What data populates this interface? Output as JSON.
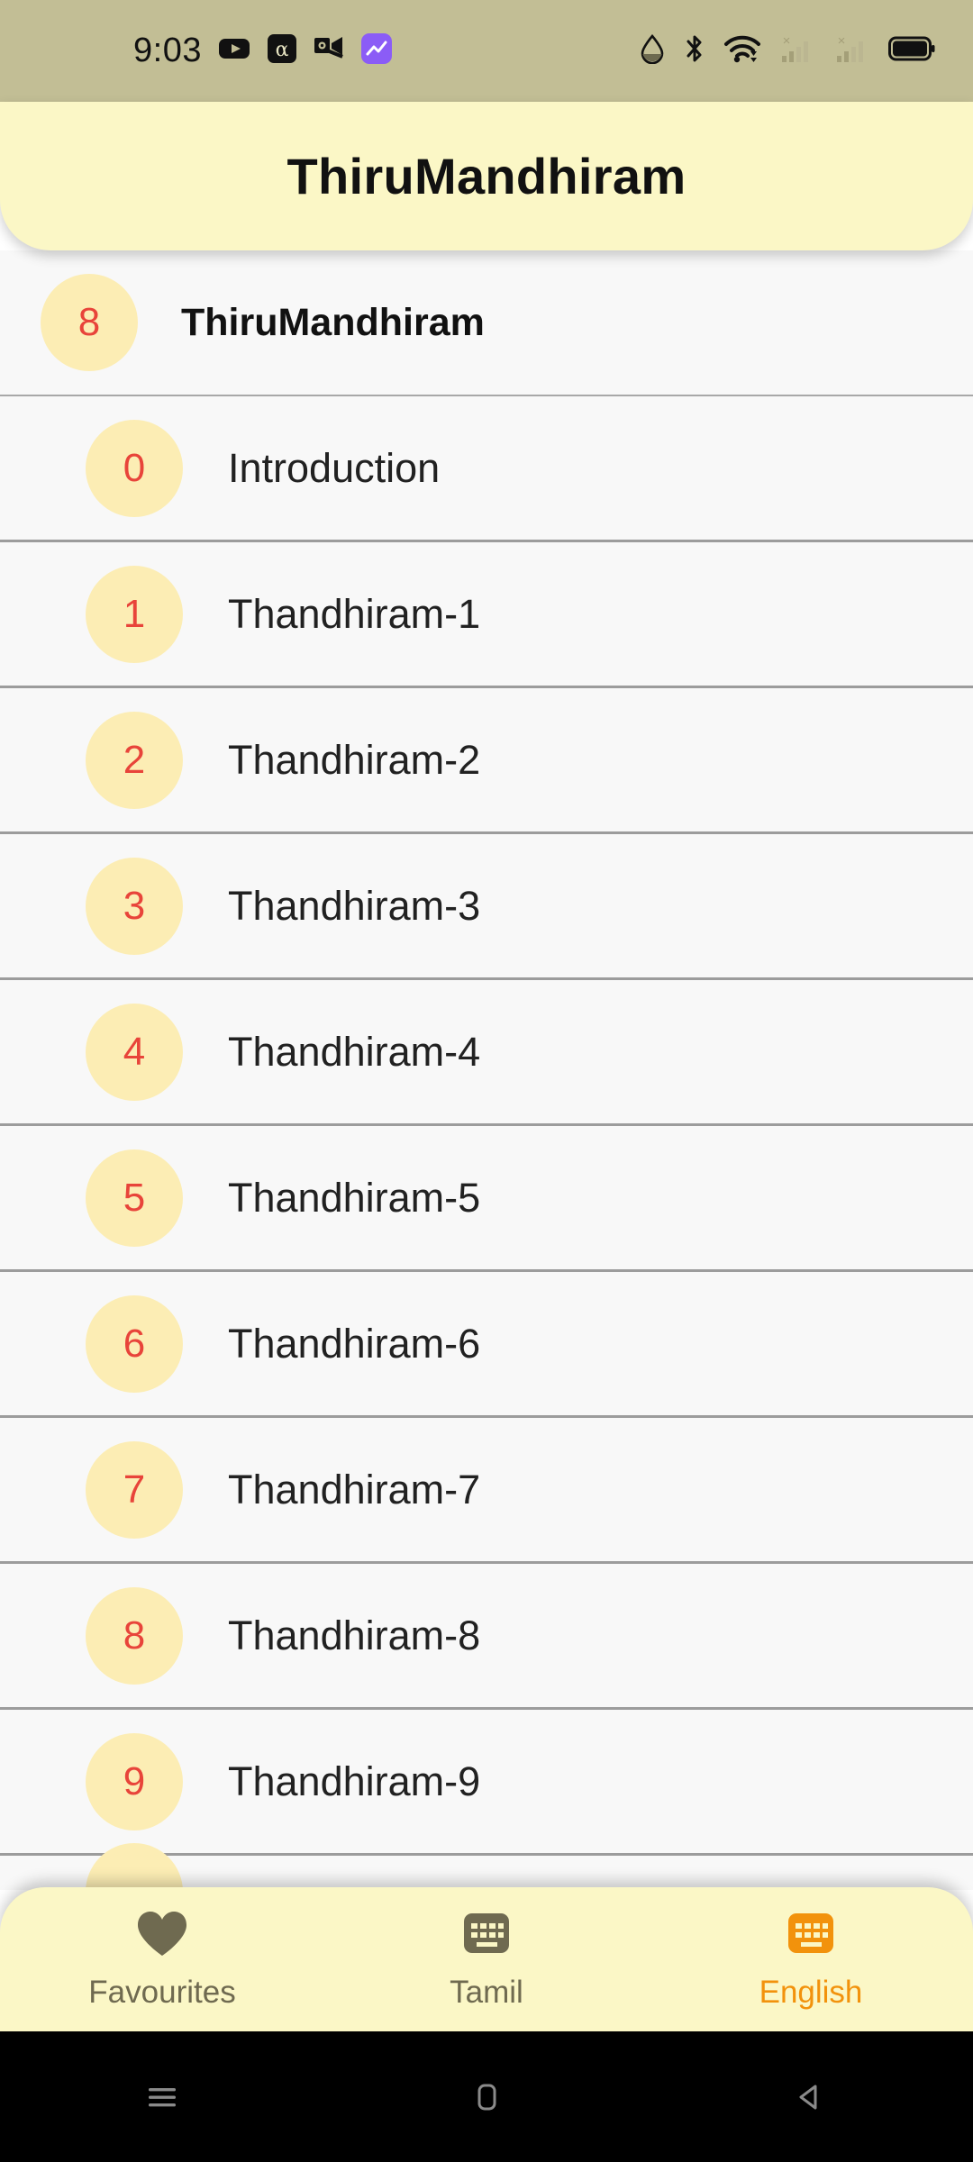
{
  "status_bar": {
    "time": "9:03",
    "background_color": "#c2be95",
    "left_icons": [
      "youtube-icon",
      "alpha-icon",
      "outlook-icon",
      "chart-app-icon"
    ],
    "right_icons": [
      "water-drop-icon",
      "bluetooth-icon",
      "wifi-icon",
      "signal-1-no-service-icon",
      "signal-2-no-service-icon",
      "battery-icon"
    ]
  },
  "header": {
    "title": "ThiruMandhiram",
    "background_color": "#fbf7c6"
  },
  "list": {
    "background_color": "#f8f8f8",
    "badge_color": "#fcedb4",
    "badge_text_color": "#e8443a",
    "items": [
      {
        "number": "8",
        "label": "ThiruMandhiram",
        "header_row": true
      },
      {
        "number": "0",
        "label": "Introduction",
        "header_row": false
      },
      {
        "number": "1",
        "label": "Thandhiram-1",
        "header_row": false
      },
      {
        "number": "2",
        "label": "Thandhiram-2",
        "header_row": false
      },
      {
        "number": "3",
        "label": "Thandhiram-3",
        "header_row": false
      },
      {
        "number": "4",
        "label": "Thandhiram-4",
        "header_row": false
      },
      {
        "number": "5",
        "label": "Thandhiram-5",
        "header_row": false
      },
      {
        "number": "6",
        "label": "Thandhiram-6",
        "header_row": false
      },
      {
        "number": "7",
        "label": "Thandhiram-7",
        "header_row": false
      },
      {
        "number": "8",
        "label": "Thandhiram-8",
        "header_row": false
      },
      {
        "number": "9",
        "label": "Thandhiram-9",
        "header_row": false
      }
    ]
  },
  "bottom_nav": {
    "background_color": "#fbf7c6",
    "active_color": "#f2920c",
    "inactive_color": "#6f6a50",
    "items": [
      {
        "label": "Favourites",
        "icon": "heart-icon",
        "active": false
      },
      {
        "label": "Tamil",
        "icon": "keyboard-icon",
        "active": false
      },
      {
        "label": "English",
        "icon": "keyboard-icon",
        "active": true
      }
    ]
  },
  "android_nav": {
    "background_color": "#000000",
    "items": [
      "recents-icon",
      "home-icon",
      "back-icon"
    ]
  }
}
